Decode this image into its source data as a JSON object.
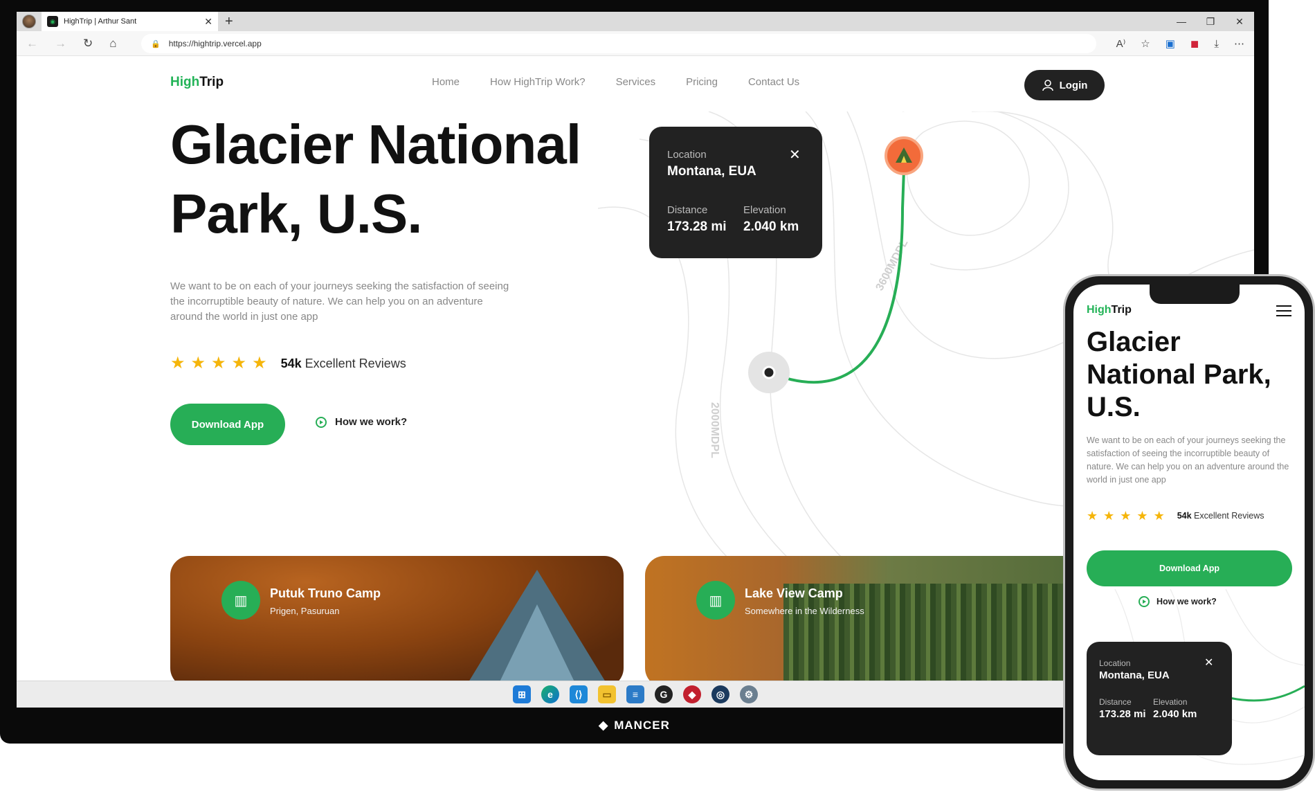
{
  "browser": {
    "tab_title": "HighTrip | Arthur Sant",
    "url": "https://hightrip.vercel.app",
    "new_tab": "+",
    "tab_close": "✕"
  },
  "site": {
    "logo_hi": "High",
    "logo_rest": "Trip",
    "nav": [
      "Home",
      "How HighTrip Work?",
      "Services",
      "Pricing",
      "Contact Us"
    ],
    "login": "Login",
    "hero_title_line1": "Glacier National",
    "hero_title_line2": "Park, U.S.",
    "hero_title_mobile": "Glacier National Park, U.S.",
    "description": "We want to be on each of your journeys seeking the satisfaction of seeing the incorruptible beauty of nature. We can help you on an adventure around the world in just one app",
    "rating": 5,
    "reviews_count": "54k",
    "reviews_label": "Excellent Reviews",
    "download_button": "Download App",
    "how_link": "How we work?"
  },
  "location_card": {
    "location_label": "Location",
    "location_value": "Montana, EUA",
    "distance_label": "Distance",
    "distance_value": "173.28 mi",
    "elevation_label": "Elevation",
    "elevation_value": "2.040 km"
  },
  "map": {
    "contour_labels": [
      "3600MDPL",
      "2000MDPL"
    ],
    "route_color": "#27ae56",
    "pin_color": "#f26b3a"
  },
  "camps": [
    {
      "name": "Putuk Truno Camp",
      "place": "Prigen, Pasuruan"
    },
    {
      "name": "Lake View Camp",
      "place": "Somewhere in the Wilderness"
    }
  ],
  "taskbar": {
    "icons": [
      "windows-icon",
      "edge-icon",
      "vscode-icon",
      "file-explorer-icon",
      "notepad-icon",
      "github-desktop-icon",
      "brave-icon",
      "steam-icon",
      "settings-icon"
    ]
  },
  "monitor_brand": "MANCER",
  "colors": {
    "accent": "#27ae56",
    "dark": "#222222",
    "star": "#f5b50a"
  }
}
